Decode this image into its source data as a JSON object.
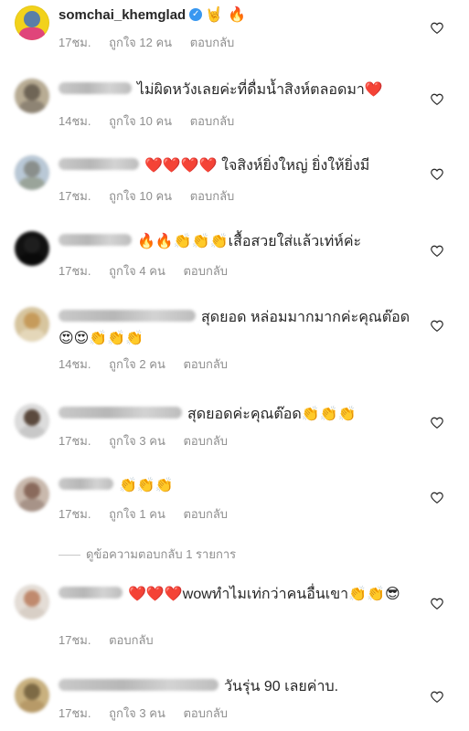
{
  "comments": [
    {
      "username": "somchai_khemglad",
      "username_visible": true,
      "verified": true,
      "text": "🤘 🔥",
      "time": "17ชม.",
      "likes": "ถูกใจ 12 คน",
      "reply": "ตอบกลับ",
      "avatar": {
        "bg": "#f2d21b",
        "fig": "#5a7ea8",
        "fig2": "#e0457a",
        "blur": false
      }
    },
    {
      "username": "",
      "text": "ไม่ผิดหวังเลยค่ะที่ดื่มน้ำสิงห์ตลอดมา❤️",
      "time": "14ชม.",
      "likes": "ถูกใจ 10 คน",
      "reply": "ตอบกลับ",
      "avatar": {
        "bg": "#b8ac94",
        "fig": "#6f6556",
        "fig2": "#8e8474",
        "blur": true
      }
    },
    {
      "username": "",
      "text": "❤️❤️❤️❤️ ใจสิงห์ยิ่งใหญ่ ยิ่งให้ยิ่งมี",
      "time": "17ชม.",
      "likes": "ถูกใจ 10 คน",
      "reply": "ตอบกลับ",
      "avatar": {
        "bg": "#b9c8d6",
        "fig": "#8a8f8c",
        "fig2": "#9aa49a",
        "blur": true
      }
    },
    {
      "username": "",
      "text": "🔥🔥👏👏👏เสื้อสวยใส่แล้วเท่ห์ค่ะ",
      "time": "17ชม.",
      "likes": "ถูกใจ 4 คน",
      "reply": "ตอบกลับ",
      "avatar": {
        "bg": "#111111",
        "fig": "#1e1e1e",
        "fig2": "#0a0a0a",
        "blur": true
      }
    },
    {
      "username": "",
      "text": "สุดยอด หล่อมมากมากค่ะคุณต๊อด😍😍👏👏👏",
      "time": "14ชม.",
      "likes": "ถูกใจ 2 คน",
      "reply": "ตอบกลับ",
      "avatar": {
        "bg": "#d7c59e",
        "fig": "#c69b5b",
        "fig2": "#e4d7b9",
        "blur": true
      }
    },
    {
      "username": "",
      "text": "สุดยอดค่ะคุณต๊อด👏👏👏",
      "time": "17ชม.",
      "likes": "ถูกใจ 3 คน",
      "reply": "ตอบกลับ",
      "avatar": {
        "bg": "#dcdcdc",
        "fig": "#5b4a3e",
        "fig2": "#c8c8c8",
        "blur": true
      }
    },
    {
      "username": "",
      "text": "👏👏👏",
      "time": "17ชม.",
      "likes": "ถูกใจ 1 คน",
      "reply": "ตอบกลับ",
      "avatar": {
        "bg": "#c9b9ad",
        "fig": "#8a6a5c",
        "fig2": "#a79388",
        "blur": true
      }
    },
    {
      "username": "",
      "text": "❤️❤️❤️wowทำไมเท่กว่าคนอื่นเขา👏👏😎",
      "time": "17ชม.",
      "likes": "",
      "reply": "ตอบกลับ",
      "avatar": {
        "bg": "#e4ddd6",
        "fig": "#c08a6e",
        "fig2": "#d8cfc6",
        "blur": true
      }
    },
    {
      "username": "",
      "text": "วันรุ่น 90 เลยค่าบ.",
      "time": "17ชม.",
      "likes": "ถูกใจ 3 คน",
      "reply": "ตอบกลับ",
      "avatar": {
        "bg": "#c9b17f",
        "fig": "#7d6a45",
        "fig2": "#b79a68",
        "blur": true
      }
    }
  ],
  "thread": {
    "label": "ดูข้อความตอบกลับ 1 รายการ"
  },
  "colors": {
    "meta": "#8e8e8e",
    "text": "#262626",
    "verified": "#3897f0"
  },
  "icons": {
    "like": "heart-outline-icon",
    "verified": "verified-badge-icon"
  }
}
